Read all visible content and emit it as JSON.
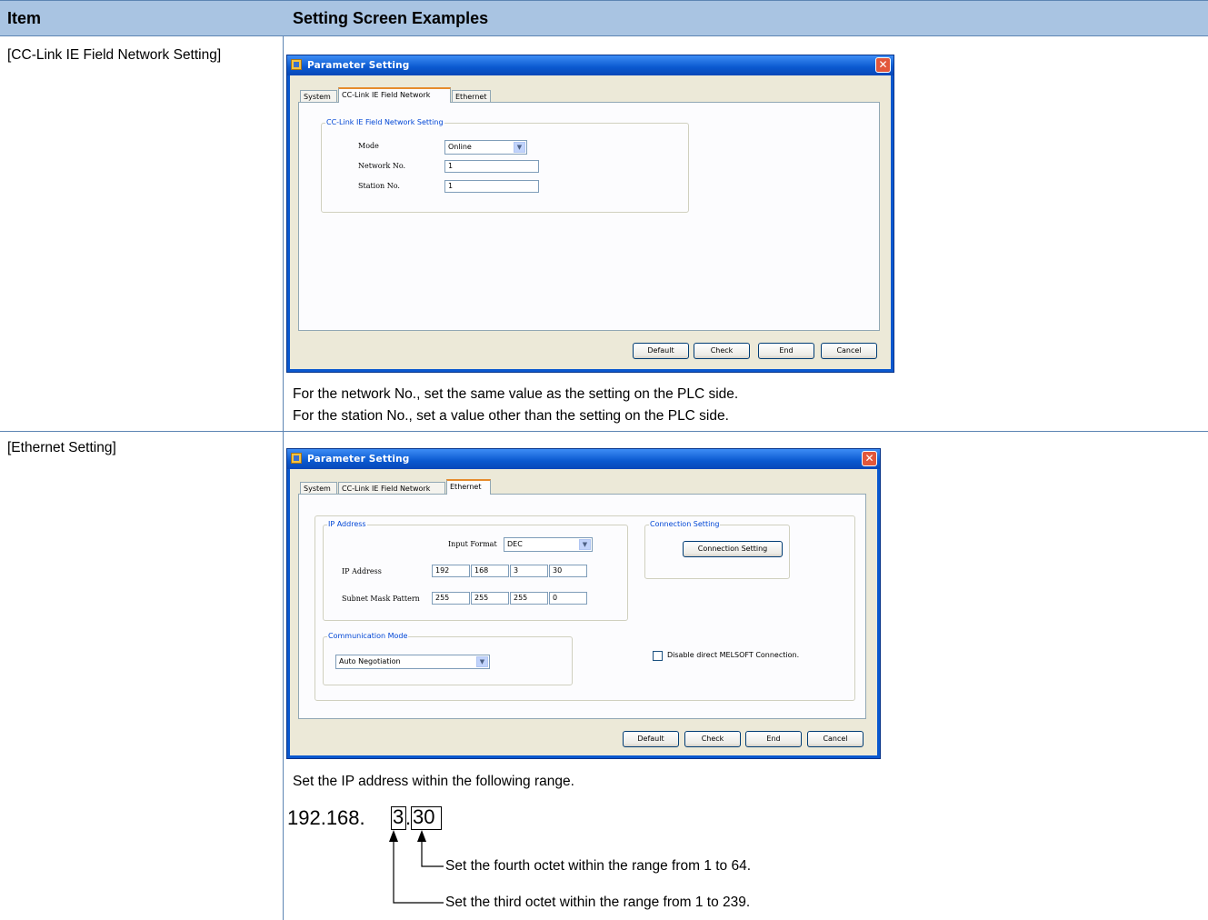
{
  "header": {
    "item": "Item",
    "examples": "Setting Screen Examples"
  },
  "rows": [
    {
      "item": "[CC-Link IE Field Network Setting]",
      "window": {
        "title": "Parameter Setting",
        "tabs": [
          "System",
          "CC-Link IE Field Network",
          "Ethernet"
        ],
        "group_title": "CC-Link IE Field Network Setting",
        "fields": [
          {
            "label": "Mode",
            "value": "Online"
          },
          {
            "label": "Network No.",
            "value": "1"
          },
          {
            "label": "Station No.",
            "value": "1"
          }
        ],
        "buttons": [
          "Default",
          "Check",
          "End",
          "Cancel"
        ]
      },
      "notes": [
        "For the network No., set the same value as the setting on the PLC side.",
        "For the station No., set a value other than the setting on the PLC side."
      ]
    },
    {
      "item": "[Ethernet Setting]",
      "window": {
        "title": "Parameter Setting",
        "tabs": [
          "System",
          "CC-Link IE Field Network",
          "Ethernet"
        ],
        "ip_group_title": "IP Address",
        "input_format_label": "Input Format",
        "input_format_value": "DEC",
        "ip_label": "IP Address",
        "ip": [
          "192",
          "168",
          "3",
          "30"
        ],
        "subnet_label": "Subnet Mask Pattern",
        "subnet": [
          "255",
          "255",
          "255",
          "0"
        ],
        "comm_group_title": "Communication Mode",
        "comm_value": "Auto Negotiation",
        "conn_group_title": "Connection Setting",
        "conn_button": "Connection Setting",
        "disable_label": "Disable direct MELSOFT Connection.",
        "buttons": [
          "Default",
          "Check",
          "End",
          "Cancel"
        ]
      },
      "note": "Set the IP address within the following range.",
      "ip_example": {
        "prefix": "192.168.",
        "third": "3",
        "dot": ".",
        "fourth": "30"
      },
      "annotations": {
        "fourth": "Set the fourth octet within the range from 1 to 64.",
        "third": "Set the third octet within the range from 1 to 239."
      }
    }
  ],
  "colors": {
    "header_bg": "#a9c4e2",
    "rule": "#5d85b3",
    "titlebar": "#0a58cf",
    "tab_accent": "#e68b2c",
    "group_label": "#0046d5"
  }
}
